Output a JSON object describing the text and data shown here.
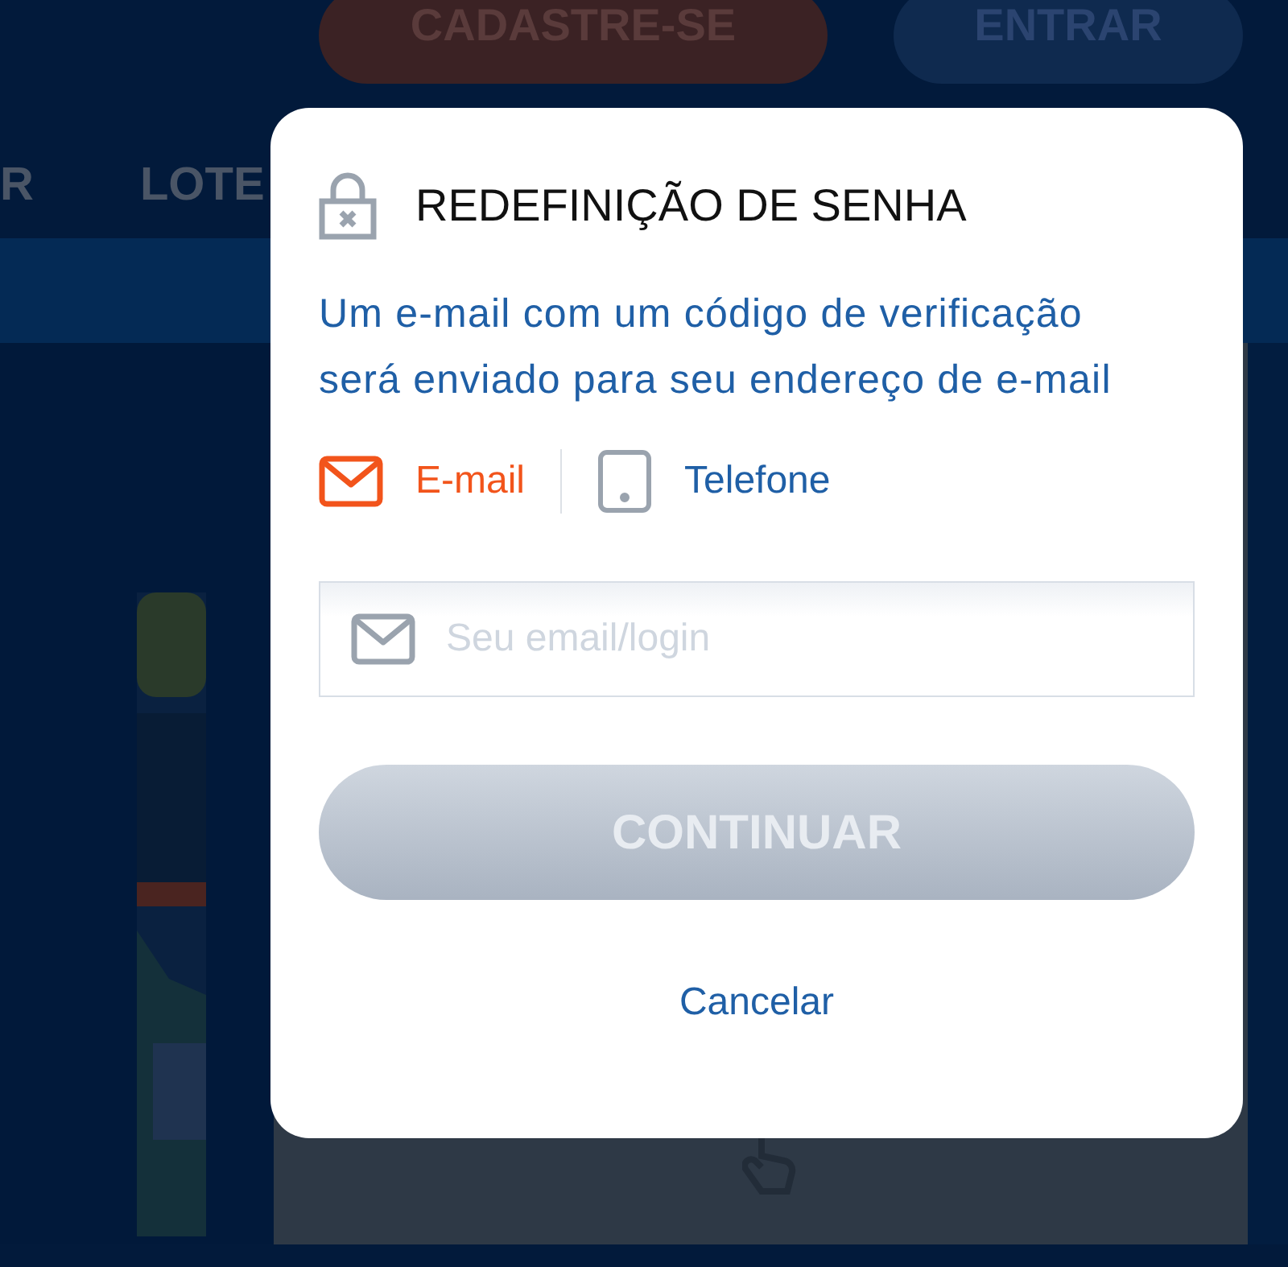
{
  "background": {
    "header_buttons": [
      {
        "label": "CADASTRE-SE",
        "kind": "primary"
      },
      {
        "label": "ENTRAR",
        "kind": "secondary"
      }
    ],
    "nav": [
      {
        "label": "R"
      },
      {
        "label": "LOTE"
      }
    ]
  },
  "dialog": {
    "title": "REDEFINIÇÃO DE SENHA",
    "description": "Um e-mail com um código de verificação será enviado para seu endereço de e-mail",
    "methods": [
      {
        "label": "E-mail",
        "kind": "email",
        "selected": true
      },
      {
        "label": "Telefone",
        "kind": "phone",
        "selected": false
      }
    ],
    "input": {
      "placeholder": "Seu email/login"
    },
    "submit": {
      "label": "CONTINUAR",
      "disabled": true
    },
    "cancel": "Cancelar"
  }
}
